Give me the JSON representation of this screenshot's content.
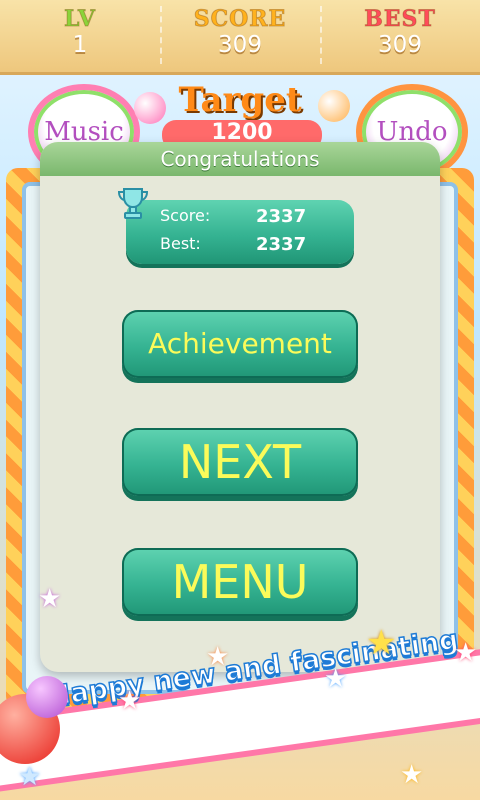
{
  "hud": {
    "lv_label": "LV",
    "lv_value": "1",
    "score_label": "SCORE",
    "score_value": "309",
    "best_label": "BEST",
    "best_value": "309"
  },
  "background": {
    "music_label": "Music",
    "undo_label": "Undo",
    "target_label": "Target",
    "target_value": "1200"
  },
  "dialog": {
    "title": "Congratulations",
    "score_label": "Score:",
    "score_value": "2337",
    "best_label": "Best:",
    "best_value": "2337",
    "achievement_label": "Achievement",
    "next_label": "NEXT",
    "menu_label": "MENU"
  },
  "banner": {
    "text": "Happy new and fascinating"
  },
  "colors": {
    "button": "#35b392",
    "button_text": "#fbfb5a",
    "title_bar": "#7ab76d",
    "lv": "#8bd33a",
    "score": "#ffb21e",
    "best": "#ff4c5a"
  }
}
